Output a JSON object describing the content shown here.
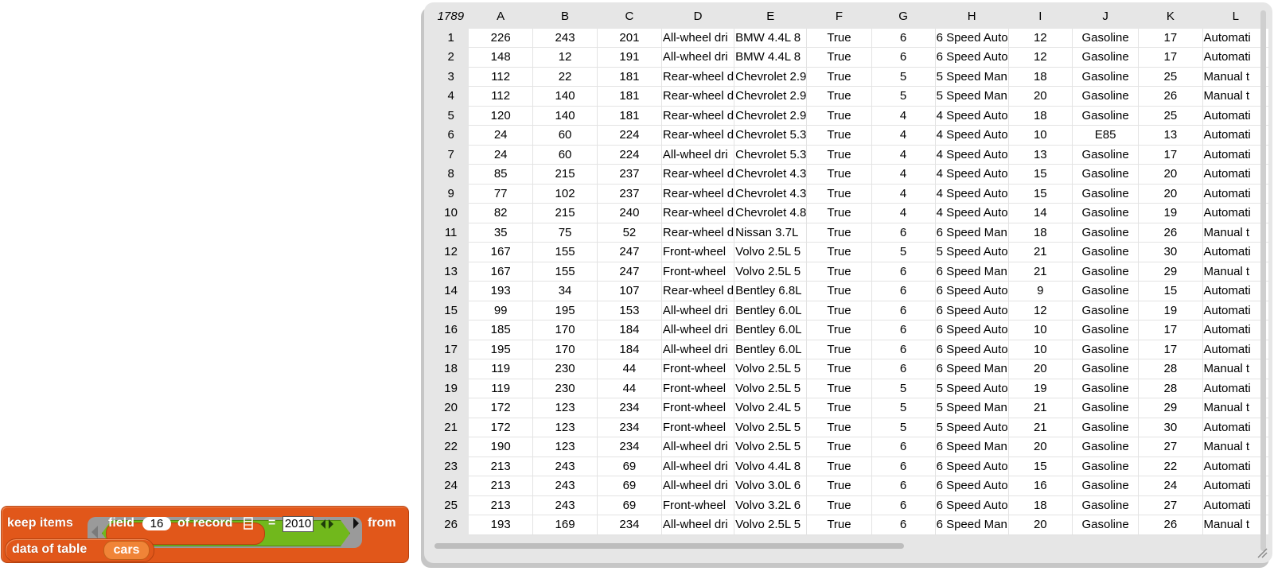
{
  "table": {
    "row_count": "1789",
    "columns": [
      "A",
      "B",
      "C",
      "D",
      "E",
      "F",
      "G",
      "H",
      "I",
      "J",
      "K",
      "L"
    ],
    "rows": [
      [
        "1",
        "226",
        "243",
        "201",
        "All-wheel dri",
        "BMW 4.4L 8",
        "True",
        "6",
        "6 Speed Auto",
        "12",
        "Gasoline",
        "17",
        "Automati"
      ],
      [
        "2",
        "148",
        "12",
        "191",
        "All-wheel dri",
        "BMW 4.4L 8",
        "True",
        "6",
        "6 Speed Auto",
        "12",
        "Gasoline",
        "17",
        "Automati"
      ],
      [
        "3",
        "112",
        "22",
        "181",
        "Rear-wheel d",
        "Chevrolet 2.9",
        "True",
        "5",
        "5 Speed Man",
        "18",
        "Gasoline",
        "25",
        "Manual t"
      ],
      [
        "4",
        "112",
        "140",
        "181",
        "Rear-wheel d",
        "Chevrolet 2.9",
        "True",
        "5",
        "5 Speed Man",
        "20",
        "Gasoline",
        "26",
        "Manual t"
      ],
      [
        "5",
        "120",
        "140",
        "181",
        "Rear-wheel d",
        "Chevrolet 2.9",
        "True",
        "4",
        "4 Speed Auto",
        "18",
        "Gasoline",
        "25",
        "Automati"
      ],
      [
        "6",
        "24",
        "60",
        "224",
        "Rear-wheel d",
        "Chevrolet 5.3",
        "True",
        "4",
        "4 Speed Auto",
        "10",
        "E85",
        "13",
        "Automati"
      ],
      [
        "7",
        "24",
        "60",
        "224",
        "All-wheel dri",
        "Chevrolet 5.3",
        "True",
        "4",
        "4 Speed Auto",
        "13",
        "Gasoline",
        "17",
        "Automati"
      ],
      [
        "8",
        "85",
        "215",
        "237",
        "Rear-wheel d",
        "Chevrolet 4.3",
        "True",
        "4",
        "4 Speed Auto",
        "15",
        "Gasoline",
        "20",
        "Automati"
      ],
      [
        "9",
        "77",
        "102",
        "237",
        "Rear-wheel d",
        "Chevrolet 4.3",
        "True",
        "4",
        "4 Speed Auto",
        "15",
        "Gasoline",
        "20",
        "Automati"
      ],
      [
        "10",
        "82",
        "215",
        "240",
        "Rear-wheel d",
        "Chevrolet 4.8",
        "True",
        "4",
        "4 Speed Auto",
        "14",
        "Gasoline",
        "19",
        "Automati"
      ],
      [
        "11",
        "35",
        "75",
        "52",
        "Rear-wheel d",
        "Nissan 3.7L",
        "True",
        "6",
        "6 Speed Man",
        "18",
        "Gasoline",
        "26",
        "Manual t"
      ],
      [
        "12",
        "167",
        "155",
        "247",
        "Front-wheel",
        "Volvo 2.5L 5",
        "True",
        "5",
        "5 Speed Auto",
        "21",
        "Gasoline",
        "30",
        "Automati"
      ],
      [
        "13",
        "167",
        "155",
        "247",
        "Front-wheel",
        "Volvo 2.5L 5",
        "True",
        "6",
        "6 Speed Man",
        "21",
        "Gasoline",
        "29",
        "Manual t"
      ],
      [
        "14",
        "193",
        "34",
        "107",
        "Rear-wheel d",
        "Bentley 6.8L",
        "True",
        "6",
        "6 Speed Auto",
        "9",
        "Gasoline",
        "15",
        "Automati"
      ],
      [
        "15",
        "99",
        "195",
        "153",
        "All-wheel dri",
        "Bentley 6.0L",
        "True",
        "6",
        "6 Speed Auto",
        "12",
        "Gasoline",
        "19",
        "Automati"
      ],
      [
        "16",
        "185",
        "170",
        "184",
        "All-wheel dri",
        "Bentley 6.0L",
        "True",
        "6",
        "6 Speed Auto",
        "10",
        "Gasoline",
        "17",
        "Automati"
      ],
      [
        "17",
        "195",
        "170",
        "184",
        "All-wheel dri",
        "Bentley 6.0L",
        "True",
        "6",
        "6 Speed Auto",
        "10",
        "Gasoline",
        "17",
        "Automati"
      ],
      [
        "18",
        "119",
        "230",
        "44",
        "Front-wheel",
        "Volvo 2.5L 5",
        "True",
        "6",
        "6 Speed Man",
        "20",
        "Gasoline",
        "28",
        "Manual t"
      ],
      [
        "19",
        "119",
        "230",
        "44",
        "Front-wheel",
        "Volvo 2.5L 5",
        "True",
        "5",
        "5 Speed Auto",
        "19",
        "Gasoline",
        "28",
        "Automati"
      ],
      [
        "20",
        "172",
        "123",
        "234",
        "Front-wheel",
        "Volvo 2.4L 5",
        "True",
        "5",
        "5 Speed Man",
        "21",
        "Gasoline",
        "29",
        "Manual t"
      ],
      [
        "21",
        "172",
        "123",
        "234",
        "Front-wheel",
        "Volvo 2.5L 5",
        "True",
        "5",
        "5 Speed Auto",
        "21",
        "Gasoline",
        "30",
        "Automati"
      ],
      [
        "22",
        "190",
        "123",
        "234",
        "All-wheel dri",
        "Volvo 2.5L 5",
        "True",
        "6",
        "6 Speed Man",
        "20",
        "Gasoline",
        "27",
        "Manual t"
      ],
      [
        "23",
        "213",
        "243",
        "69",
        "All-wheel dri",
        "Volvo 4.4L 8",
        "True",
        "6",
        "6 Speed Auto",
        "15",
        "Gasoline",
        "22",
        "Automati"
      ],
      [
        "24",
        "213",
        "243",
        "69",
        "All-wheel dri",
        "Volvo 3.0L 6",
        "True",
        "6",
        "6 Speed Auto",
        "16",
        "Gasoline",
        "24",
        "Automati"
      ],
      [
        "25",
        "213",
        "243",
        "69",
        "Front-wheel",
        "Volvo 3.2L 6",
        "True",
        "6",
        "6 Speed Auto",
        "18",
        "Gasoline",
        "27",
        "Automati"
      ],
      [
        "26",
        "193",
        "169",
        "234",
        "All-wheel dri",
        "Volvo 2.5L 5",
        "True",
        "6",
        "6 Speed Man",
        "20",
        "Gasoline",
        "26",
        "Manual t"
      ]
    ]
  },
  "script": {
    "keep_label": "keep items",
    "field_label": "field",
    "field_index": "16",
    "of_record_label": "of record",
    "equals_label": "=",
    "compare_value": "2010",
    "from_label": "from",
    "data_of_table_label": "data of table",
    "table_name": "cars"
  },
  "colors": {
    "block_orange": "#e1571a",
    "predicate_green": "#71b81c",
    "ring_gray": "#9a9a9a",
    "watcher_gray": "#e6e6e6"
  }
}
